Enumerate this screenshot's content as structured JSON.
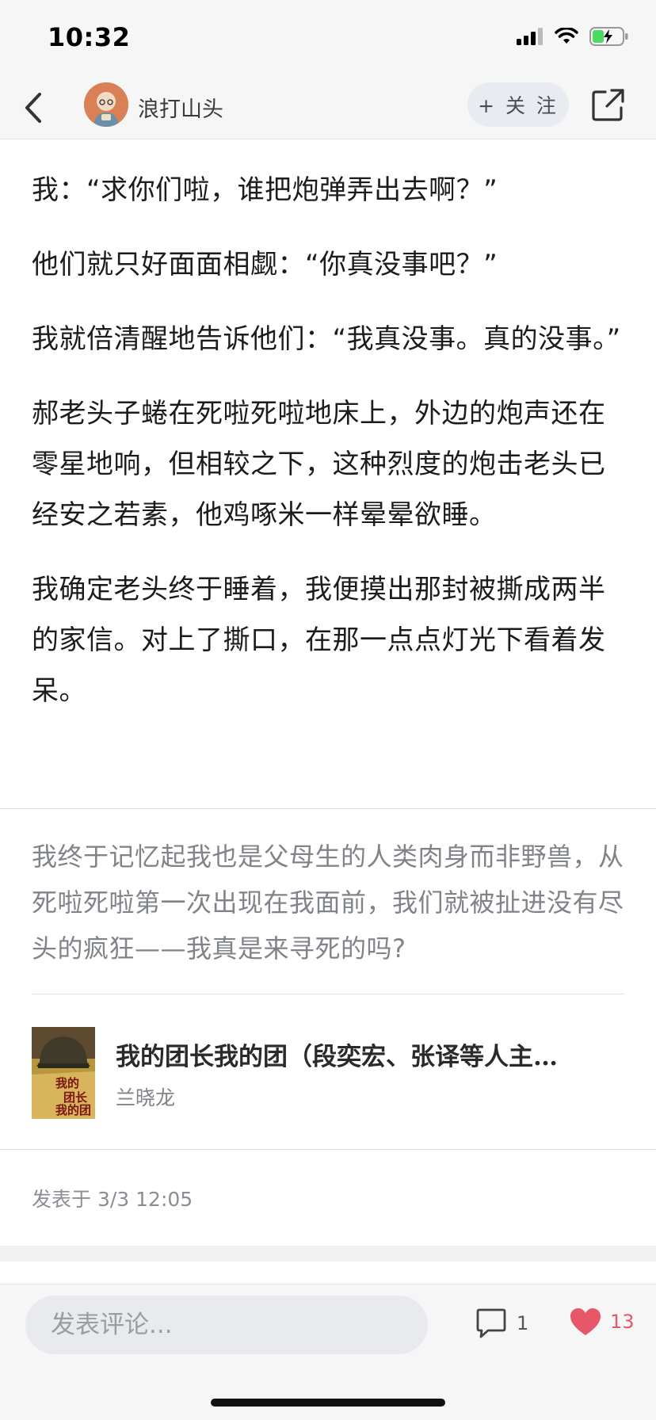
{
  "status_bar": {
    "time": "10:32",
    "icons": [
      "cellular-signal-icon",
      "wifi-icon",
      "battery-charging-icon"
    ]
  },
  "nav": {
    "back_icon": "chevron-left-icon",
    "author_name": "浪打山头",
    "follow_label": "+ 关 注",
    "share_icon": "share-external-icon"
  },
  "article": {
    "paragraphs": [
      "我：“求你们啦，谁把炮弹弄出去啊？”",
      "他们就只好面面相觑：“你真没事吧？”",
      "我就倍清醒地告诉他们：“我真没事。真的没事。”",
      "郝老头子蜷在死啦死啦地床上，外边的炮声还在零星地响，但相较之下，这种烈度的炮击老头已经安之若素，他鸡啄米一样晕晕欲睡。",
      "我确定老头终于睡着，我便摸出那封被撕成两半的家信。对上了撕口，在那一点点灯光下看着发呆。"
    ]
  },
  "quote": "我终于记忆起我也是父母生的人类肉身而非野兽，从死啦死啦第一次出现在我面前，我们就被扯进没有尽头的疯狂——我真是来寻死的吗?",
  "book": {
    "title": "我的团长我的团（段奕宏、张译等人主…",
    "author": "兰晓龙",
    "cover_text": "我的团长我的团"
  },
  "publish_time": "发表于 3/3 12:05",
  "bottom_bar": {
    "comment_placeholder": "发表评论...",
    "comment_count": "1",
    "like_count": "13",
    "comment_icon": "comment-bubble-icon",
    "like_icon": "heart-icon"
  },
  "colors": {
    "accent_like": "#e8566a",
    "background_bar": "#f6f6f7",
    "follow_bg": "#e8ebf0"
  }
}
